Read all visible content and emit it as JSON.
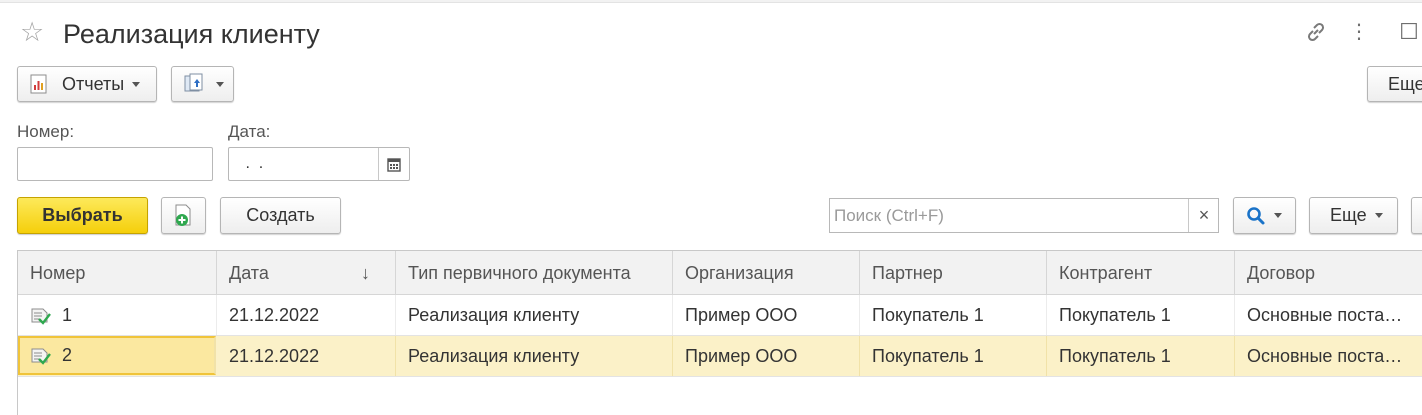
{
  "window": {
    "title": "Реализация клиенту"
  },
  "icons": {
    "favorite": "☆",
    "link": "🔗",
    "menu": "⋮",
    "maximize": "☐",
    "calendar": "▦",
    "clear": "×",
    "sort_down": "↓"
  },
  "toolbar": {
    "reports_label": "Отчеты",
    "more_label": "Еще"
  },
  "form": {
    "number_label": "Номер:",
    "number_value": "",
    "date_label": "Дата:",
    "date_value": " .  ."
  },
  "list_toolbar": {
    "select_label": "Выбрать",
    "create_label": "Создать",
    "search_placeholder": "Поиск (Ctrl+F)",
    "more_label": "Еще"
  },
  "table": {
    "columns": [
      "Номер",
      "Дата",
      "Тип первичного документа",
      "Организация",
      "Партнер",
      "Контрагент",
      "Договор"
    ],
    "rows": [
      {
        "number": "1",
        "date": "21.12.2022",
        "type": "Реализация клиенту",
        "org": "Пример ООО",
        "partner": "Покупатель 1",
        "counterparty": "Покупатель 1",
        "contract": "Основные поставки"
      },
      {
        "number": "2",
        "date": "21.12.2022",
        "type": "Реализация клиенту",
        "org": "Пример ООО",
        "partner": "Покупатель 1",
        "counterparty": "Покупатель 1",
        "contract": "Основные поставки"
      }
    ],
    "selected_row": 1
  },
  "colors": {
    "accent_yellow": "#f5cf0b",
    "selected_row": "#fbf1c8",
    "search_icon": "#1a73c8"
  }
}
